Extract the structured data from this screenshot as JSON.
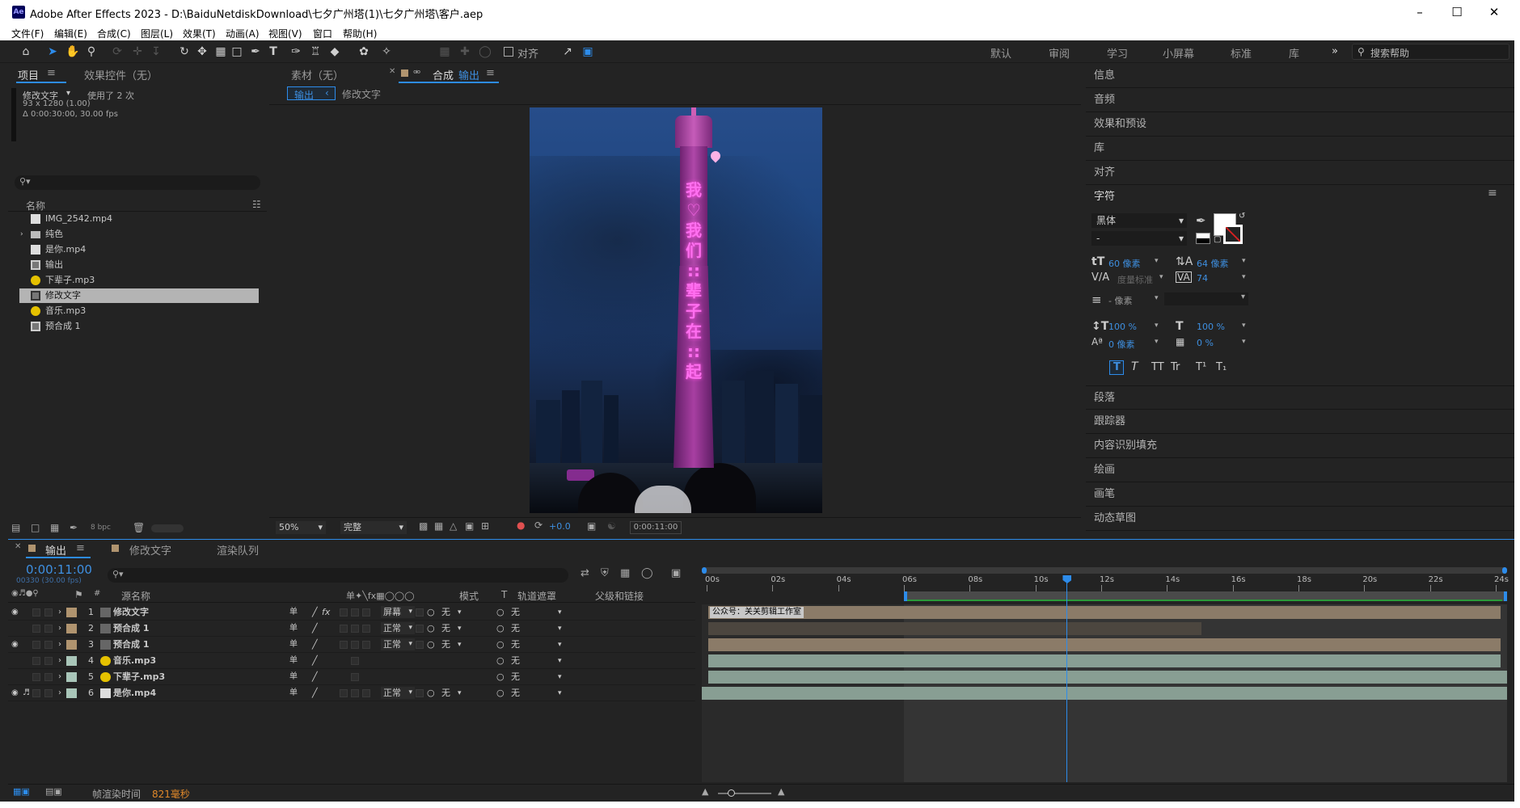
{
  "titlebar": {
    "app_badge": "Ae",
    "title": "Adobe After Effects 2023 - D:\\BaiduNetdiskDownload\\七夕广州塔(1)\\七夕广州塔\\客户.aep"
  },
  "menu": [
    "文件(F)",
    "编辑(E)",
    "合成(C)",
    "图层(L)",
    "效果(T)",
    "动画(A)",
    "视图(V)",
    "窗口",
    "帮助(H)"
  ],
  "toolbar": {
    "align_label": "对齐",
    "workspaces": [
      "默认",
      "审阅",
      "学习",
      "小屏幕",
      "标准",
      "库"
    ],
    "more": "»",
    "help_placeholder": "搜索帮助"
  },
  "project": {
    "tab": "项目",
    "effects_tab": "效果控件（无）",
    "info_name": "修改文字",
    "info_used": "使用了 2 次",
    "info_dims": "93 x 1280 (1.00)",
    "info_duration": "Δ 0:00:30:00, 30.00 fps",
    "col_name": "名称",
    "items": [
      {
        "name": "IMG_2542.mp4",
        "type": "file"
      },
      {
        "name": "纯色",
        "type": "folder"
      },
      {
        "name": "是你.mp4",
        "type": "file"
      },
      {
        "name": "输出",
        "type": "comp"
      },
      {
        "name": "下辈子.mp3",
        "type": "audio"
      },
      {
        "name": "修改文字",
        "type": "comp",
        "selected": true
      },
      {
        "name": "音乐.mp3",
        "type": "audio"
      },
      {
        "name": "预合成 1",
        "type": "comp"
      }
    ],
    "bpc": "8 bpc"
  },
  "viewer": {
    "footage_tab": "素材（无）",
    "comp_prefix": "合成",
    "comp_name": "输出",
    "breadcrumb": [
      "输出",
      "修改文字"
    ],
    "zoom": "50%",
    "quality": "完整",
    "exposure": "+0.0",
    "timecode": "0:00:11:00",
    "tower_text": [
      "我",
      "♡",
      "我",
      "们",
      "::",
      "辈",
      "子",
      "在",
      "::",
      "起"
    ]
  },
  "right": {
    "panels_top": [
      "信息",
      "音频",
      "效果和预设",
      "库",
      "对齐"
    ],
    "character_title": "字符",
    "font_family": "黑体",
    "font_style": "-",
    "font_size": "60 像素",
    "leading": "64 像素",
    "kerning": "度量标准",
    "tracking": "74",
    "stroke": "- 像素",
    "vscale": "100 %",
    "hscale": "100 %",
    "baseline": "0 像素",
    "tsume": "0 %",
    "styles": [
      "T",
      "T",
      "TT",
      "Tr",
      "T¹",
      "T₁"
    ],
    "panels_bottom": [
      "段落",
      "跟踪器",
      "内容识别填充",
      "绘画",
      "画笔",
      "动态草图"
    ]
  },
  "timeline": {
    "tabs": [
      "输出",
      "修改文字",
      "渲染队列"
    ],
    "timecode": "0:00:11:00",
    "frames": "00330 (30.00 fps)",
    "col_source": "源名称",
    "col_mode": "模式",
    "col_t": "T",
    "col_track": "轨道遮罩",
    "col_parent": "父级和链接",
    "ruler": [
      "00s",
      "02s",
      "04s",
      "06s",
      "08s",
      "10s",
      "12s",
      "14s",
      "16s",
      "18s",
      "20s",
      "22s",
      "24s"
    ],
    "playhead_fraction": 0.4583,
    "layers": [
      {
        "num": "1",
        "name": "修改文字",
        "mode": "屏幕",
        "track": "无",
        "parent": "无",
        "label_color": "#b0946f",
        "eye": true,
        "fx": "fx"
      },
      {
        "num": "2",
        "name": "预合成 1",
        "mode": "正常",
        "track": "无",
        "parent": "无",
        "label_color": "#b0946f",
        "eye": false,
        "fx": ""
      },
      {
        "num": "3",
        "name": "预合成 1",
        "mode": "正常",
        "track": "无",
        "parent": "无",
        "label_color": "#b0946f",
        "eye": true,
        "fx": ""
      },
      {
        "num": "4",
        "name": "音乐.mp3",
        "mode": "",
        "track": "",
        "parent": "无",
        "label_color": "#a9c6b9",
        "eye": false,
        "fx": ""
      },
      {
        "num": "5",
        "name": "下辈子.mp3",
        "mode": "",
        "track": "",
        "parent": "无",
        "label_color": "#a9c6b9",
        "eye": false,
        "fx": ""
      },
      {
        "num": "6",
        "name": "是你.mp4",
        "mode": "正常",
        "track": "无",
        "parent": "无",
        "label_color": "#a9c6b9",
        "eye": true,
        "fx": ""
      }
    ],
    "marker_text": "公众号：关关剪辑工作室",
    "render_label": "帧渲染时间",
    "render_value": "821毫秒"
  },
  "colors": {
    "accent": "#2d8ceb",
    "panel": "#232323",
    "work_area": "#2b9a3a"
  }
}
